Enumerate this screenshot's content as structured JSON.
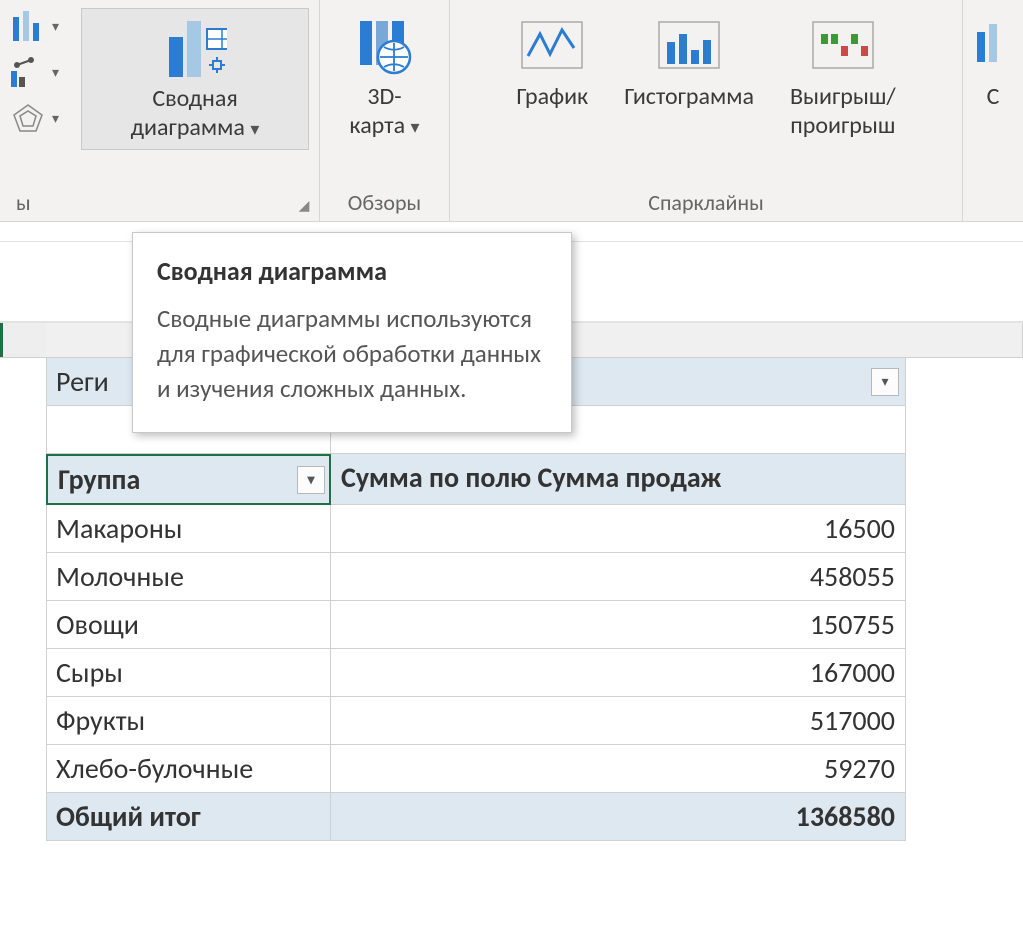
{
  "ribbon": {
    "group_charts_label": "ы",
    "group_tours_label": "Обзоры",
    "group_spark_label": "Спарклайны",
    "pivot_chart": {
      "line1": "Сводная",
      "line2": "диаграмма"
    },
    "map3d": {
      "line1": "3D-",
      "line2": "карта"
    },
    "spark_line": "График",
    "spark_column": "Гистограмма",
    "spark_winloss": {
      "line1": "Выигрыш/",
      "line2": "проигрыш"
    },
    "next_partial": "С"
  },
  "tooltip": {
    "title": "Сводная диаграмма",
    "body": "Сводные диаграммы используются для графической обработки данных и изучения сложных данных."
  },
  "pivot": {
    "filter_label": "Реги",
    "row_header": "Группа",
    "value_header": "Сумма по полю Сумма продаж",
    "rows": [
      {
        "label": "Макароны",
        "value": "16500"
      },
      {
        "label": "Молочные",
        "value": "458055"
      },
      {
        "label": "Овощи",
        "value": "150755"
      },
      {
        "label": "Сыры",
        "value": "167000"
      },
      {
        "label": "Фрукты",
        "value": "517000"
      },
      {
        "label": "Хлебо-булочные",
        "value": "59270"
      }
    ],
    "total_label": "Общий итог",
    "total_value": "1368580"
  }
}
